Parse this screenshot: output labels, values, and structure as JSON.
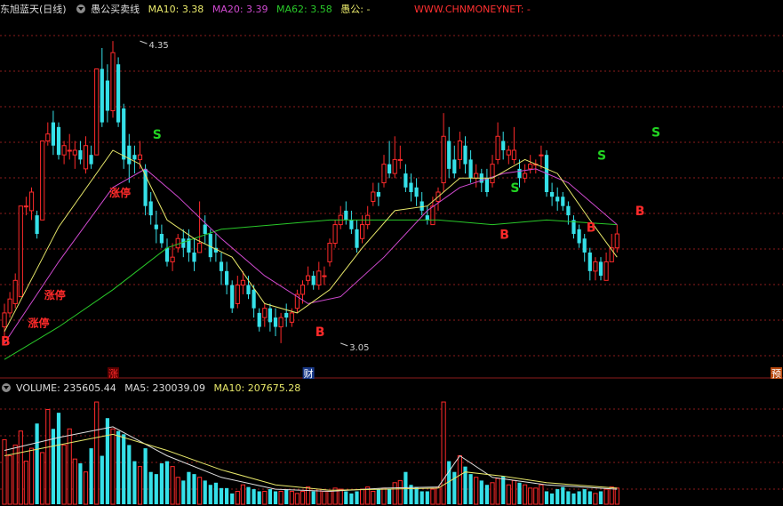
{
  "header": {
    "stock_name": "东旭蓝天(日线)",
    "indicator_name": "愚公买卖线",
    "ma10_label": "MA10:",
    "ma10_value": "3.38",
    "ma20_label": "MA20:",
    "ma20_value": "3.39",
    "ma62_label": "MA62:",
    "ma62_value": "3.58",
    "yugong_label": "愚公:",
    "yugong_value": "-",
    "watermark": "WWW.CHNMONEYNET: -"
  },
  "volume_header": {
    "volume_label": "VOLUME:",
    "volume_value": "235605.44",
    "ma5_label": "MA5:",
    "ma5_value": "230039.09",
    "ma10_label": "MA10:",
    "ma10_value": "207675.28"
  },
  "colors": {
    "up": "#ff2a2a",
    "down": "#35e0e8",
    "ma10": "#e8e86a",
    "ma20": "#d04ad0",
    "ma62": "#29c829",
    "grid": "#8b1c1c",
    "buy": "#ff2a2a",
    "sell": "#22d422",
    "zt": "#ff2a2a",
    "watermark": "#ff3030"
  },
  "chart_data": {
    "type": "candlestick",
    "title": "东旭蓝天(日线)",
    "ylim": [
      2.95,
      4.45
    ],
    "grid": true,
    "price_high_label": "4.35",
    "price_low_label": "3.05",
    "candles": [
      [
        3.12,
        3.18,
        3.22,
        3.08
      ],
      [
        3.18,
        3.24,
        3.27,
        3.16
      ],
      [
        3.22,
        3.32,
        3.35,
        3.2
      ],
      [
        3.25,
        3.64,
        3.64,
        3.25
      ],
      [
        3.64,
        3.64,
        3.68,
        3.6
      ],
      [
        3.62,
        3.7,
        3.72,
        3.58
      ],
      [
        3.6,
        3.52,
        3.62,
        3.5
      ],
      [
        3.58,
        3.92,
        3.92,
        3.58
      ],
      [
        3.92,
        3.95,
        4.0,
        3.9
      ],
      [
        4.0,
        3.9,
        4.05,
        3.86
      ],
      [
        3.98,
        3.86,
        4.0,
        3.84
      ],
      [
        3.86,
        3.9,
        3.92,
        3.82
      ],
      [
        3.88,
        3.88,
        3.95,
        3.84
      ],
      [
        3.86,
        3.88,
        3.92,
        3.8
      ],
      [
        3.88,
        3.84,
        3.92,
        3.82
      ],
      [
        3.8,
        3.9,
        3.94,
        3.78
      ],
      [
        3.86,
        3.82,
        3.9,
        3.8
      ],
      [
        3.86,
        4.23,
        4.23,
        3.86
      ],
      [
        4.23,
        4.0,
        4.32,
        3.98
      ],
      [
        4.18,
        4.05,
        4.25,
        4.0
      ],
      [
        4.05,
        4.3,
        4.35,
        4.02
      ],
      [
        4.25,
        4.0,
        4.28,
        3.98
      ],
      [
        4.06,
        3.84,
        4.08,
        3.8
      ],
      [
        3.9,
        3.82,
        3.95,
        3.74
      ],
      [
        3.86,
        3.84,
        3.9,
        3.78
      ],
      [
        3.84,
        3.86,
        3.92,
        3.8
      ],
      [
        3.8,
        3.64,
        3.82,
        3.6
      ],
      [
        3.66,
        3.6,
        3.7,
        3.56
      ],
      [
        3.56,
        3.54,
        3.62,
        3.48
      ],
      [
        3.52,
        3.48,
        3.56,
        3.46
      ],
      [
        3.46,
        3.4,
        3.5,
        3.38
      ],
      [
        3.4,
        3.42,
        3.48,
        3.36
      ],
      [
        3.46,
        3.5,
        3.52,
        3.44
      ],
      [
        3.5,
        3.46,
        3.54,
        3.42
      ],
      [
        3.5,
        3.44,
        3.54,
        3.4
      ],
      [
        3.44,
        3.4,
        3.5,
        3.36
      ],
      [
        3.44,
        3.48,
        3.66,
        3.44
      ],
      [
        3.56,
        3.52,
        3.6,
        3.48
      ],
      [
        3.52,
        3.42,
        3.54,
        3.4
      ],
      [
        3.46,
        3.44,
        3.52,
        3.4
      ],
      [
        3.4,
        3.36,
        3.44,
        3.3
      ],
      [
        3.36,
        3.3,
        3.4,
        3.26
      ],
      [
        3.3,
        3.2,
        3.32,
        3.18
      ],
      [
        3.22,
        3.3,
        3.34,
        3.2
      ],
      [
        3.3,
        3.32,
        3.36,
        3.26
      ],
      [
        3.3,
        3.26,
        3.34,
        3.24
      ],
      [
        3.28,
        3.2,
        3.3,
        3.16
      ],
      [
        3.18,
        3.12,
        3.2,
        3.1
      ],
      [
        3.16,
        3.2,
        3.22,
        3.12
      ],
      [
        3.2,
        3.14,
        3.22,
        3.1
      ],
      [
        3.16,
        3.12,
        3.2,
        3.08
      ],
      [
        3.12,
        3.16,
        3.18,
        3.05
      ],
      [
        3.18,
        3.16,
        3.22,
        3.12
      ],
      [
        3.14,
        3.18,
        3.2,
        3.12
      ],
      [
        3.2,
        3.26,
        3.28,
        3.18
      ],
      [
        3.26,
        3.3,
        3.32,
        3.22
      ],
      [
        3.32,
        3.34,
        3.38,
        3.3
      ],
      [
        3.34,
        3.3,
        3.36,
        3.28
      ],
      [
        3.3,
        3.36,
        3.4,
        3.28
      ],
      [
        3.34,
        3.34,
        3.38,
        3.3
      ],
      [
        3.4,
        3.48,
        3.5,
        3.38
      ],
      [
        3.48,
        3.56,
        3.58,
        3.46
      ],
      [
        3.56,
        3.6,
        3.64,
        3.54
      ],
      [
        3.62,
        3.58,
        3.66,
        3.56
      ],
      [
        3.58,
        3.54,
        3.62,
        3.52
      ],
      [
        3.54,
        3.46,
        3.58,
        3.44
      ],
      [
        3.5,
        3.56,
        3.6,
        3.48
      ],
      [
        3.56,
        3.6,
        3.64,
        3.54
      ],
      [
        3.66,
        3.7,
        3.74,
        3.64
      ],
      [
        3.7,
        3.68,
        3.74,
        3.64
      ],
      [
        3.74,
        3.82,
        3.86,
        3.72
      ],
      [
        3.82,
        3.78,
        3.92,
        3.76
      ],
      [
        3.78,
        3.84,
        3.94,
        3.76
      ],
      [
        3.84,
        3.84,
        3.9,
        3.8
      ],
      [
        3.78,
        3.72,
        3.82,
        3.7
      ],
      [
        3.74,
        3.7,
        3.78,
        3.66
      ],
      [
        3.72,
        3.68,
        3.76,
        3.64
      ],
      [
        3.66,
        3.62,
        3.7,
        3.6
      ],
      [
        3.6,
        3.58,
        3.64,
        3.56
      ],
      [
        3.56,
        3.64,
        3.68,
        3.56
      ],
      [
        3.66,
        3.7,
        3.72,
        3.62
      ],
      [
        3.74,
        3.94,
        4.04,
        3.7
      ],
      [
        3.92,
        3.8,
        3.98,
        3.76
      ],
      [
        3.84,
        3.78,
        3.9,
        3.76
      ],
      [
        3.84,
        3.92,
        3.96,
        3.8
      ],
      [
        3.9,
        3.82,
        3.94,
        3.78
      ],
      [
        3.84,
        3.76,
        3.88,
        3.74
      ],
      [
        3.76,
        3.78,
        3.82,
        3.72
      ],
      [
        3.78,
        3.74,
        3.8,
        3.7
      ],
      [
        3.76,
        3.7,
        3.8,
        3.68
      ],
      [
        3.74,
        3.82,
        3.86,
        3.72
      ],
      [
        3.84,
        3.94,
        4.0,
        3.82
      ],
      [
        3.92,
        3.88,
        3.96,
        3.84
      ],
      [
        3.86,
        3.88,
        3.9,
        3.82
      ],
      [
        3.84,
        3.88,
        3.98,
        3.82
      ],
      [
        3.8,
        3.76,
        3.84,
        3.72
      ],
      [
        3.76,
        3.78,
        3.82,
        3.74
      ],
      [
        3.8,
        3.82,
        3.86,
        3.78
      ],
      [
        3.82,
        3.82,
        3.84,
        3.78
      ],
      [
        3.86,
        3.86,
        3.9,
        3.8
      ],
      [
        3.86,
        3.7,
        3.88,
        3.68
      ],
      [
        3.7,
        3.68,
        3.74,
        3.64
      ],
      [
        3.68,
        3.66,
        3.72,
        3.62
      ],
      [
        3.68,
        3.64,
        3.7,
        3.62
      ],
      [
        3.64,
        3.6,
        3.66,
        3.56
      ],
      [
        3.58,
        3.52,
        3.6,
        3.5
      ],
      [
        3.54,
        3.48,
        3.56,
        3.46
      ],
      [
        3.5,
        3.44,
        3.52,
        3.4
      ],
      [
        3.44,
        3.36,
        3.46,
        3.32
      ],
      [
        3.36,
        3.4,
        3.42,
        3.32
      ],
      [
        3.4,
        3.34,
        3.42,
        3.32
      ],
      [
        3.32,
        3.4,
        3.44,
        3.32
      ],
      [
        3.4,
        3.46,
        3.52,
        3.4
      ],
      [
        3.46,
        3.52,
        3.56,
        3.44
      ]
    ],
    "volume": [
      60,
      45,
      55,
      68,
      40,
      52,
      75,
      48,
      88,
      70,
      85,
      55,
      70,
      42,
      38,
      30,
      52,
      95,
      45,
      80,
      70,
      68,
      65,
      55,
      40,
      35,
      52,
      30,
      28,
      38,
      40,
      35,
      25,
      22,
      30,
      28,
      25,
      22,
      18,
      20,
      15,
      15,
      10,
      12,
      18,
      16,
      14,
      12,
      12,
      14,
      12,
      12,
      14,
      12,
      10,
      12,
      16,
      12,
      14,
      12,
      12,
      15,
      14,
      12,
      10,
      12,
      14,
      16,
      12,
      14,
      15,
      14,
      20,
      22,
      30,
      18,
      16,
      12,
      12,
      14,
      16,
      95,
      40,
      30,
      45,
      35,
      28,
      25,
      22,
      18,
      20,
      24,
      26,
      18,
      22,
      20,
      18,
      15,
      15,
      18,
      12,
      10,
      14,
      16,
      12,
      10,
      12,
      14,
      12,
      10,
      12,
      14,
      16,
      15,
      14,
      16
    ],
    "ma10_line": [
      [
        0,
        3.1
      ],
      [
        10,
        3.55
      ],
      [
        20,
        3.88
      ],
      [
        25,
        3.82
      ],
      [
        30,
        3.58
      ],
      [
        35,
        3.5
      ],
      [
        42,
        3.42
      ],
      [
        48,
        3.22
      ],
      [
        54,
        3.18
      ],
      [
        60,
        3.28
      ],
      [
        66,
        3.46
      ],
      [
        72,
        3.62
      ],
      [
        78,
        3.64
      ],
      [
        84,
        3.76
      ],
      [
        90,
        3.76
      ],
      [
        96,
        3.84
      ],
      [
        102,
        3.78
      ],
      [
        108,
        3.58
      ],
      [
        113,
        3.42
      ]
    ],
    "ma20_line": [
      [
        0,
        3.05
      ],
      [
        10,
        3.4
      ],
      [
        20,
        3.72
      ],
      [
        26,
        3.8
      ],
      [
        32,
        3.68
      ],
      [
        40,
        3.5
      ],
      [
        48,
        3.34
      ],
      [
        56,
        3.22
      ],
      [
        62,
        3.25
      ],
      [
        70,
        3.42
      ],
      [
        78,
        3.62
      ],
      [
        84,
        3.72
      ],
      [
        92,
        3.78
      ],
      [
        98,
        3.8
      ],
      [
        104,
        3.74
      ],
      [
        113,
        3.56
      ]
    ],
    "ma62_line": [
      [
        0,
        2.98
      ],
      [
        10,
        3.12
      ],
      [
        20,
        3.28
      ],
      [
        30,
        3.46
      ],
      [
        40,
        3.54
      ],
      [
        50,
        3.56
      ],
      [
        60,
        3.58
      ],
      [
        70,
        3.58
      ],
      [
        80,
        3.58
      ],
      [
        90,
        3.56
      ],
      [
        100,
        3.58
      ],
      [
        113,
        3.56
      ]
    ],
    "vol_ma5_line": [
      [
        0,
        50
      ],
      [
        10,
        62
      ],
      [
        20,
        72
      ],
      [
        30,
        45
      ],
      [
        40,
        25
      ],
      [
        50,
        14
      ],
      [
        60,
        12
      ],
      [
        70,
        15
      ],
      [
        80,
        16
      ],
      [
        84,
        45
      ],
      [
        90,
        25
      ],
      [
        100,
        18
      ],
      [
        113,
        14
      ]
    ],
    "vol_ma10_line": [
      [
        0,
        45
      ],
      [
        10,
        55
      ],
      [
        20,
        65
      ],
      [
        30,
        50
      ],
      [
        40,
        32
      ],
      [
        50,
        18
      ],
      [
        60,
        13
      ],
      [
        70,
        14
      ],
      [
        80,
        15
      ],
      [
        85,
        30
      ],
      [
        92,
        26
      ],
      [
        100,
        20
      ],
      [
        113,
        15
      ]
    ],
    "annotations": [
      {
        "idx": 0,
        "price": 3.04,
        "text": "B",
        "kind": "buy"
      },
      {
        "idx": 5,
        "price": 3.12,
        "text": "涨停",
        "kind": "zt"
      },
      {
        "idx": 8,
        "price": 3.24,
        "text": "涨停",
        "kind": "zt"
      },
      {
        "idx": 20,
        "price": 3.68,
        "text": "涨停",
        "kind": "zt"
      },
      {
        "idx": 28,
        "price": 3.93,
        "text": "S",
        "kind": "sell"
      },
      {
        "idx": 58,
        "price": 3.08,
        "text": "B",
        "kind": "buy"
      },
      {
        "idx": 92,
        "price": 3.5,
        "text": "B",
        "kind": "buy"
      },
      {
        "idx": 94,
        "price": 3.7,
        "text": "S",
        "kind": "sell"
      },
      {
        "idx": 108,
        "price": 3.53,
        "text": "B",
        "kind": "buy"
      },
      {
        "idx": 110,
        "price": 3.84,
        "text": "S",
        "kind": "sell"
      },
      {
        "idx": 117,
        "price": 3.6,
        "text": "B",
        "kind": "buy"
      },
      {
        "idx": 120,
        "price": 3.94,
        "text": "S",
        "kind": "sell"
      }
    ],
    "event_markers": [
      {
        "idx": 20,
        "text": "涨",
        "color": "#ff2a2a",
        "bg": "#5a0000"
      },
      {
        "idx": 56,
        "text": "财",
        "color": "#ffffff",
        "bg": "#1a3a8a"
      },
      {
        "idx": 143,
        "text": "预",
        "color": "#ffffff",
        "bg": "#b84a10"
      }
    ]
  }
}
